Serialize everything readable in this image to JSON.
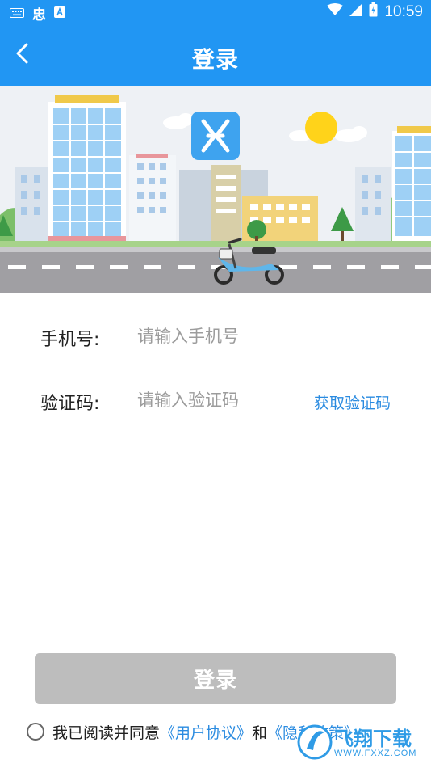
{
  "status_bar": {
    "carrier_text": "忠",
    "time": "10:59",
    "icons": [
      "keyboard-icon",
      "carrier-icon",
      "notification-a-icon",
      "wifi-icon",
      "signal-icon",
      "battery-icon"
    ]
  },
  "header": {
    "title": "登录",
    "back_icon": "chevron-left-icon",
    "background_color": "#2196f3"
  },
  "banner": {
    "logo_icon": "app-logo-icon",
    "scene": "city-street-scooter-illustration"
  },
  "form": {
    "phone": {
      "label": "手机号:",
      "placeholder": "请输入手机号",
      "value": ""
    },
    "code": {
      "label": "验证码:",
      "placeholder": "请输入验证码",
      "value": "",
      "get_code_label": "获取验证码"
    }
  },
  "login_button": {
    "label": "登录",
    "color": "#bdbdbd"
  },
  "agreement": {
    "checked": false,
    "prefix": "我已阅读并同意",
    "user_agreement_link": "《用户协议》",
    "conjunction": "和",
    "privacy_link": "《隐私政策》"
  },
  "watermark": {
    "text": "飞翔下载",
    "url": "WWW.FXXZ.COM"
  },
  "colors": {
    "primary": "#2196f3",
    "link": "#2a8be0",
    "disabled_button": "#bdbdbd"
  }
}
